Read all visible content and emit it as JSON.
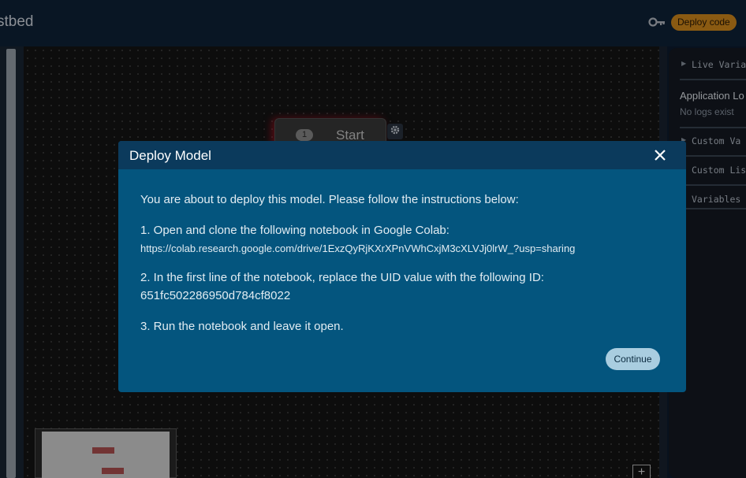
{
  "header": {
    "app_title": "stbed",
    "key_icon": "key-icon",
    "deploy_button": "Deploy code"
  },
  "canvas": {
    "start_node": {
      "badge": "1",
      "label": "Start"
    },
    "gear_icon": "gear-icon",
    "zoom_in": "+"
  },
  "right_panel": {
    "live_variables": "Live Varia",
    "application_logs": "Application Lo",
    "no_logs": "No logs exist",
    "custom_variables": "Custom Va",
    "custom_lists": "Custom Lis",
    "variables": "Variables"
  },
  "modal": {
    "title": "Deploy Model",
    "close_icon": "close-icon",
    "intro": "You are about to deploy this model. Please follow the instructions below:",
    "step1": "1. Open and clone the following notebook in Google Colab:",
    "step1_link": "https://colab.research.google.com/drive/1ExzQyRjKXrXPnVWhCxjM3cXLVJj0lrW_?usp=sharing",
    "step2": "2. In the first line of the notebook, replace the UID value with the following ID:",
    "step2_id": "651fc502286950d784cf8022",
    "step3": "3. Run the notebook and leave it open.",
    "continue": "Continue"
  },
  "colors": {
    "accent": "#d48a1c",
    "modal_bg": "#04557e",
    "modal_header": "#0b3a5c"
  }
}
